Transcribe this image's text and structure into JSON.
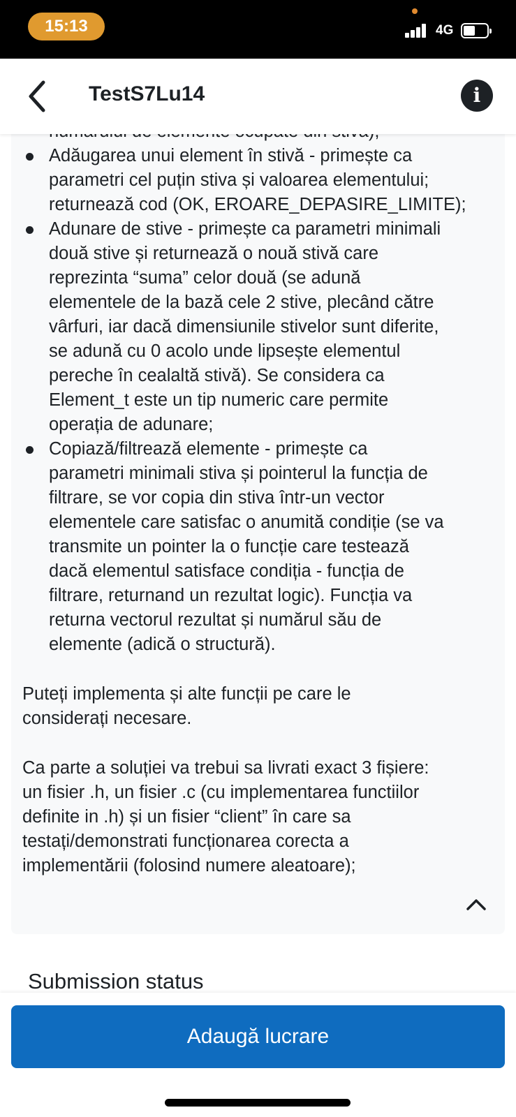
{
  "status_bar": {
    "time": "15:13",
    "network": "4G"
  },
  "header": {
    "title": "TestS7Lu14",
    "back_icon": "chevron-left-icon",
    "info_icon": "info-icon",
    "info_glyph": "i"
  },
  "content": {
    "top_line": "numărului de elemente ocupate din stivă);",
    "bullets": [
      {
        "lines": [
          "Adăugarea unui element în stivă - primește ca",
          "parametri cel puțin stiva și valoarea elementului;",
          "returnează cod (OK, EROARE_DEPASIRE_LIMITE);"
        ]
      },
      {
        "lines": [
          "Adunare de stive - primește ca parametri minimali",
          "două stive și returnează o nouă stivă care",
          "reprezinta “suma” celor două (se adună",
          "elementele de la bază cele 2 stive, plecând către",
          "vârfuri, iar dacă dimensiunile stivelor sunt diferite,",
          "se adună cu 0 acolo unde lipsește elementul",
          "pereche în cealaltă stivă). Se considera ca",
          "Element_t este un tip numeric care permite",
          "operația de adunare;"
        ]
      },
      {
        "lines": [
          "Copiază/filtrează elemente - primește ca",
          "parametri minimali stiva și pointerul la funcția de",
          "filtrare, se vor copia din stiva într-un vector",
          "elementele care satisfac o anumită condiție (se va",
          "transmite un pointer la o funcție care testează",
          "dacă elementul satisface condiția - funcția de",
          "filtrare, returnand un rezultat logic). Funcția va",
          "returna vectorul rezultat și numărul său de",
          "elemente (adică o structură)."
        ]
      }
    ],
    "paragraph1": [
      "Puteți implementa și alte funcții pe care le",
      "considerați necesare."
    ],
    "paragraph2": [
      "Ca parte a soluției va trebui sa livrati exact 3 fișiere:",
      "un fisier .h, un fisier .c (cu implementarea functiilor",
      "definite in .h) și un fisier “client” în care sa",
      "testați/demonstrati funcționarea corecta a",
      "implementării (folosind numere aleatoare);"
    ],
    "collapse_icon": "chevron-up-icon"
  },
  "submission": {
    "heading": "Submission status"
  },
  "actions": {
    "add_label": "Adaugă lucrare"
  },
  "colors": {
    "primary": "#0f6cbf",
    "status_time_bg": "#e09a2f",
    "card_bg": "#f8f9fa",
    "text": "#1d2125"
  }
}
